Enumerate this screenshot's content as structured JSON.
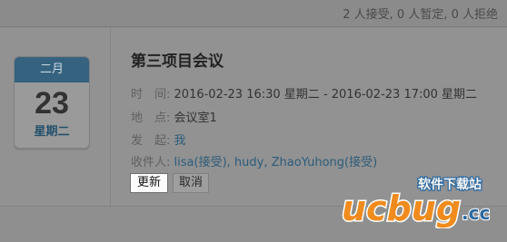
{
  "summary": {
    "text": "2 人接受, 0 人暂定, 0 人拒绝"
  },
  "calendar": {
    "month": "二月",
    "day": "23",
    "weekday": "星期二"
  },
  "event": {
    "title": "第三项目会议",
    "time_label": "时　间:",
    "time_value": "2016-02-23 16:30 星期二 - 2016-02-23 17:00 星期二",
    "place_label": "地　点:",
    "place_value": "会议室1",
    "organizer_label": "发　起:",
    "organizer_value": "我",
    "recipients_label": "收件人:",
    "recipients": [
      {
        "text": "lisa(接受)",
        "sep": ", "
      },
      {
        "text": "hudy",
        "sep": ", "
      },
      {
        "text": "ZhaoYuhong(接受)",
        "sep": ""
      }
    ]
  },
  "actions": {
    "update_label": "更新",
    "cancel_label": "取消"
  },
  "watermark": {
    "top_text": "软件下载站",
    "main_text": "ucbug",
    "suffix": ".cc"
  }
}
